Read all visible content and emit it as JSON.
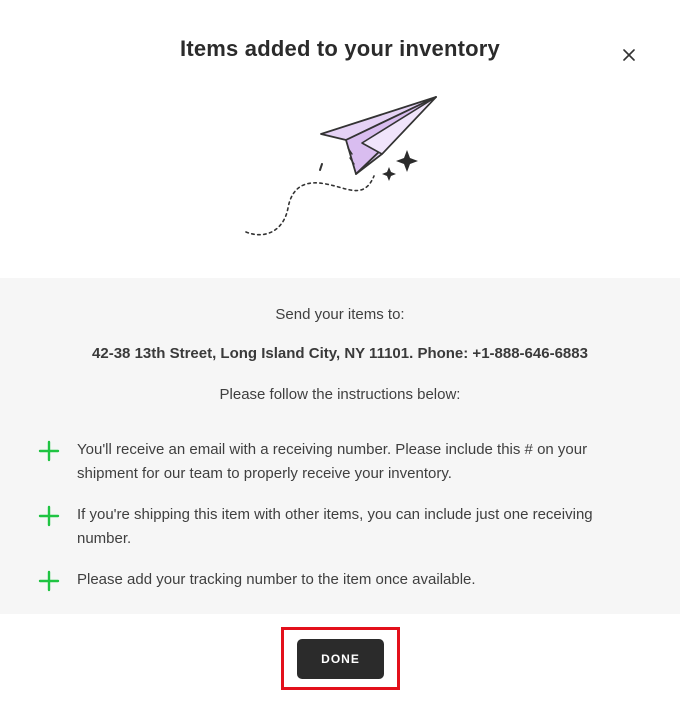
{
  "modal": {
    "title": "Items added to your inventory",
    "close_icon": "close-icon"
  },
  "illustration": {
    "icon": "paper-plane-icon",
    "accent_color": "#e5d2f5"
  },
  "shipping": {
    "send_label": "Send your items to:",
    "address": "42-38 13th Street, Long Island City, NY 11101. Phone: +1-888-646-6883",
    "instructions_label": "Please follow the instructions below:",
    "bullet_icon": "plus-icon",
    "bullet_color": "#1fc442",
    "instructions": [
      "You'll receive an email with a receiving number. Please include this # on your shipment for our team to properly receive your inventory.",
      "If you're shipping this item with other items, you can include just one receiving number.",
      "Please add your tracking number to the item once available."
    ]
  },
  "footer": {
    "done_label": "DONE",
    "highlight_color": "#e3101b"
  }
}
